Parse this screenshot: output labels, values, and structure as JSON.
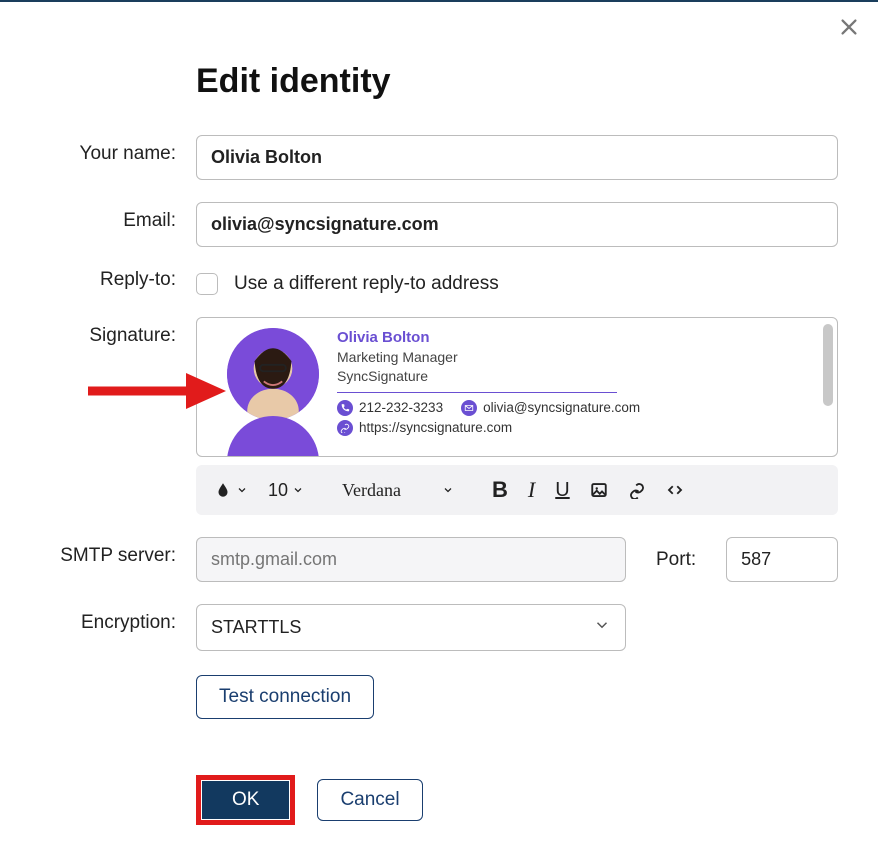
{
  "dialog": {
    "title": "Edit identity"
  },
  "labels": {
    "your_name": "Your name:",
    "email": "Email:",
    "reply_to": "Reply-to:",
    "signature": "Signature:",
    "smtp": "SMTP server:",
    "port": "Port:",
    "encryption": "Encryption:"
  },
  "fields": {
    "your_name": "Olivia Bolton",
    "email": "olivia@syncsignature.com",
    "reply_to_checkbox_label": "Use a different reply-to address",
    "smtp_placeholder": "smtp.gmail.com",
    "port_value": "587",
    "encryption_value": "STARTTLS"
  },
  "signature": {
    "name": "Olivia Bolton",
    "role": "Marketing Manager",
    "company": "SyncSignature",
    "phone": "212-232-3233",
    "email": "olivia@syncsignature.com",
    "url": "https://syncsignature.com"
  },
  "toolbar": {
    "font_size": "10",
    "font_family": "Verdana"
  },
  "buttons": {
    "test": "Test connection",
    "ok": "OK",
    "cancel": "Cancel"
  }
}
